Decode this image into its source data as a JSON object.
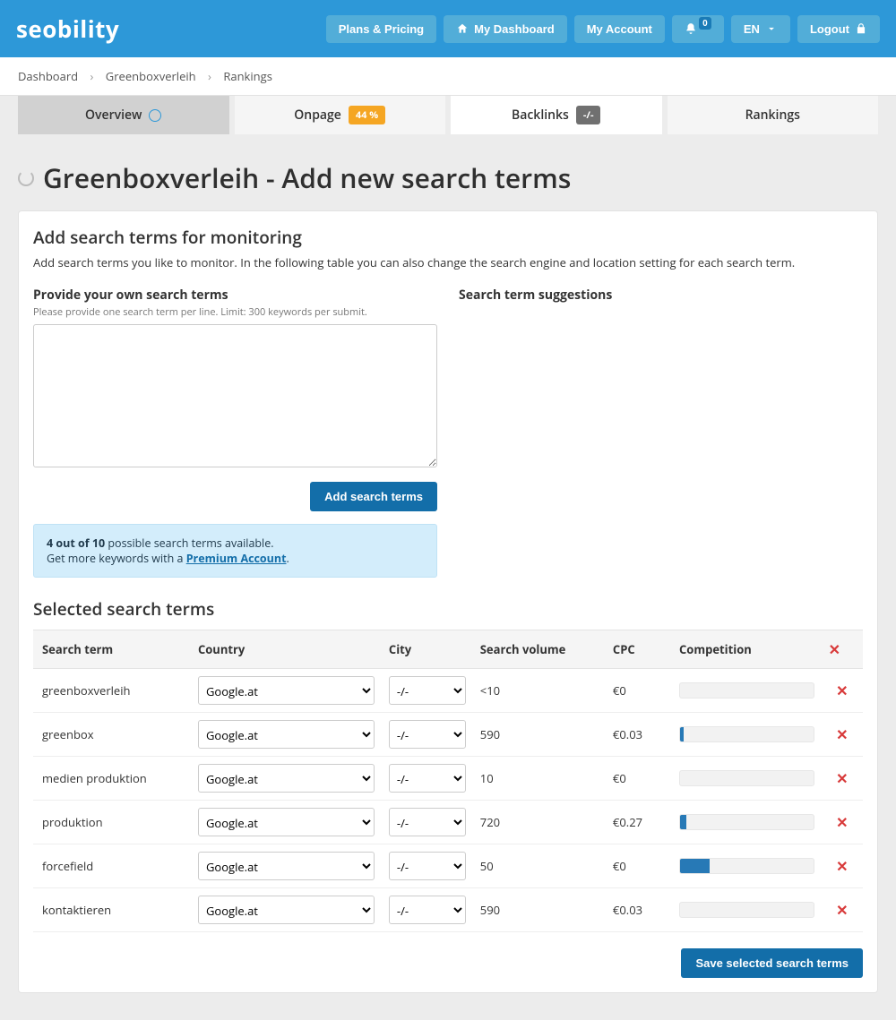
{
  "brand": "seobility",
  "topnav": {
    "plans": "Plans & Pricing",
    "dashboard": "My Dashboard",
    "account": "My Account",
    "notif_count": "0",
    "lang": "EN",
    "logout": "Logout"
  },
  "breadcrumb": {
    "a": "Dashboard",
    "b": "Greenboxverleih",
    "c": "Rankings"
  },
  "tabs": {
    "overview": "Overview",
    "onpage": "Onpage",
    "onpage_pct": "44 %",
    "backlinks": "Backlinks",
    "backlinks_badge": "-/-",
    "rankings": "Rankings"
  },
  "page_title": "Greenboxverleih - Add new search terms",
  "section": {
    "heading": "Add search terms for monitoring",
    "lead": "Add search terms you like to monitor. In the following table you can also change the search engine and location setting for each search term.",
    "own_label": "Provide your own search terms",
    "own_help": "Please provide one search term per line. Limit: 300 keywords per submit.",
    "sugg_label": "Search term suggestions",
    "add_btn": "Add search terms"
  },
  "notice": {
    "bold": "4 out of 10",
    "rest1": " possible search terms available.",
    "line2a": "Get more keywords with a ",
    "link": "Premium Account",
    "line2b": "."
  },
  "selected_heading": "Selected search terms",
  "th": {
    "term": "Search term",
    "country": "Country",
    "city": "City",
    "vol": "Search volume",
    "cpc": "CPC",
    "comp": "Competition"
  },
  "country_option": "Google.at",
  "city_option": "-/-",
  "rows": [
    {
      "term": "greenboxverleih",
      "vol": "<10",
      "cpc": "€0",
      "comp": 0
    },
    {
      "term": "greenbox",
      "vol": "590",
      "cpc": "€0.03",
      "comp": 3
    },
    {
      "term": "medien produktion",
      "vol": "10",
      "cpc": "€0",
      "comp": 0
    },
    {
      "term": "produktion",
      "vol": "720",
      "cpc": "€0.27",
      "comp": 5
    },
    {
      "term": "forcefield",
      "vol": "50",
      "cpc": "€0",
      "comp": 22
    },
    {
      "term": "kontaktieren",
      "vol": "590",
      "cpc": "€0.03",
      "comp": 0
    }
  ],
  "save_btn": "Save selected search terms"
}
